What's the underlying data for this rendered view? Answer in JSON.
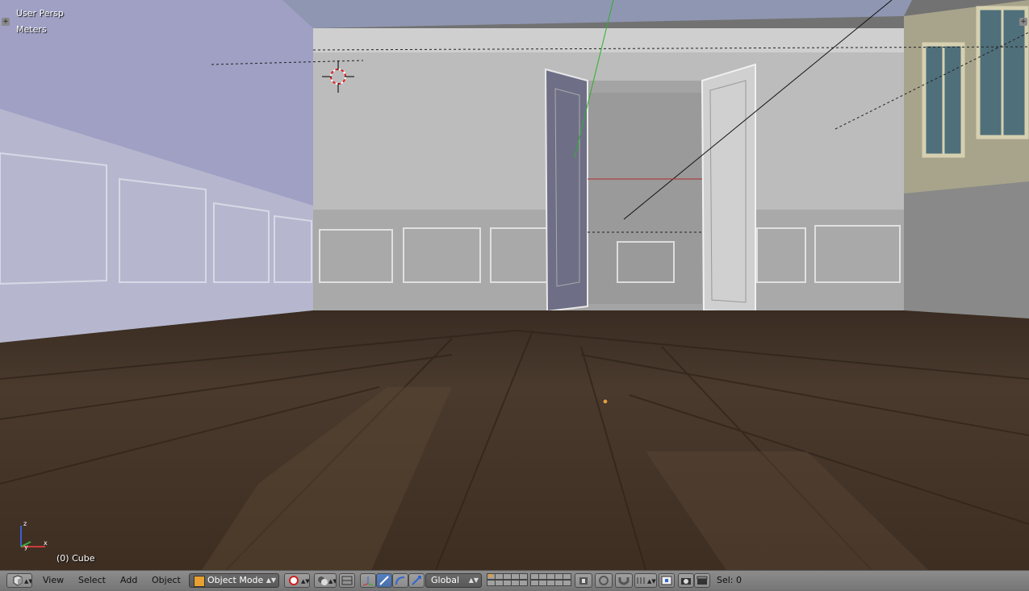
{
  "viewport": {
    "view_name": "User Persp",
    "units": "Meters",
    "active_object": "(0) Cube"
  },
  "toolbar": {
    "menus": [
      "View",
      "Select",
      "Add",
      "Object"
    ],
    "mode": "Object Mode",
    "transform_orientation": "Global",
    "selection_info": "Sel: 0"
  },
  "icons": {
    "editor_type": "cube-icon",
    "pivot": "pivot-icon",
    "shading": "shading-icon",
    "manipulator": "manipulator-icon",
    "proportional": "proportional-icon",
    "snap": "magnet-icon",
    "render": "camera-icon",
    "anim": "clapper-icon"
  },
  "colors": {
    "toolbar_bg": "#808080",
    "floor": "#4a3828",
    "wall": "#b8b8b8",
    "highlight_blue": "#5680c2"
  }
}
